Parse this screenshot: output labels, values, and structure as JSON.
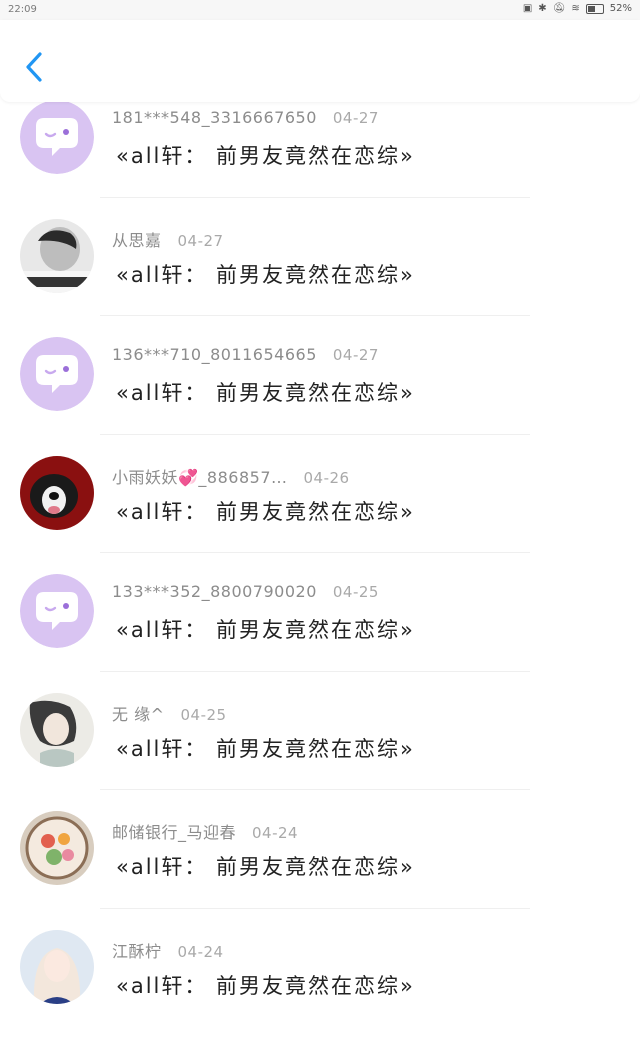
{
  "status_bar": {
    "time": "22:09",
    "battery": "52%"
  },
  "header": {
    "back_icon": "chevron-left-icon",
    "accent_color": "#2196f3"
  },
  "comments": [
    {
      "name": "181***548_3316667650",
      "date": "04-27",
      "message": "«all轩：  前男友竟然在恋综»",
      "avatar": "default"
    },
    {
      "name": "从思嘉",
      "date": "04-27",
      "message": "«all轩：  前男友竟然在恋综»",
      "avatar": "photo-bw"
    },
    {
      "name": "136***710_8011654665",
      "date": "04-27",
      "message": "«all轩：  前男友竟然在恋综»",
      "avatar": "default"
    },
    {
      "name": "小雨妖妖💞_886857…",
      "date": "04-26",
      "message": "«all轩：  前男友竟然在恋综»",
      "avatar": "photo-dog"
    },
    {
      "name": "133***352_8800790020",
      "date": "04-25",
      "message": "«all轩：  前男友竟然在恋综»",
      "avatar": "default"
    },
    {
      "name": "无 缘^",
      "date": "04-25",
      "message": "«all轩：  前男友竟然在恋综»",
      "avatar": "photo-drawing"
    },
    {
      "name": "邮储银行_马迎春",
      "date": "04-24",
      "message": "«all轩：  前男友竟然在恋综»",
      "avatar": "photo-food"
    },
    {
      "name": "江酥柠",
      "date": "04-24",
      "message": "«all轩：  前男友竟然在恋综»",
      "avatar": "photo-girl"
    }
  ]
}
